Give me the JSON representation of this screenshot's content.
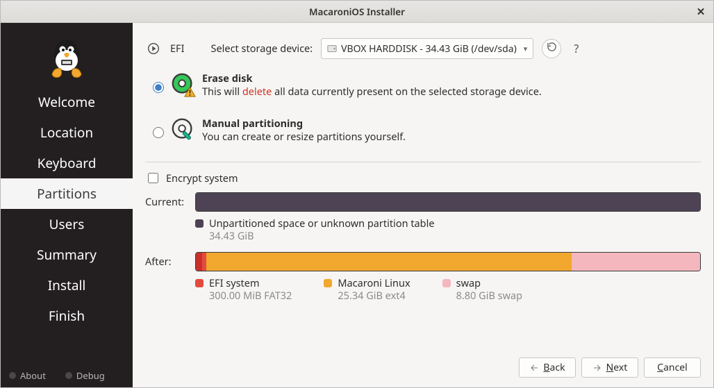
{
  "window": {
    "title": "MacaroniOS Installer"
  },
  "sidebar": {
    "items": [
      {
        "label": "Welcome"
      },
      {
        "label": "Location"
      },
      {
        "label": "Keyboard"
      },
      {
        "label": "Partitions"
      },
      {
        "label": "Users"
      },
      {
        "label": "Summary"
      },
      {
        "label": "Install"
      },
      {
        "label": "Finish"
      }
    ],
    "active_index": 3,
    "footer": {
      "about": "About",
      "debug": "Debug"
    }
  },
  "topbar": {
    "efi_label": "EFI",
    "select_label": "Select storage device:",
    "device_text": "VBOX HARDDISK    - 34.43 GiB (/dev/sda)",
    "help": "?"
  },
  "options": {
    "erase": {
      "title": "Erase disk",
      "desc_pre": "This will ",
      "desc_danger": "delete",
      "desc_post": " all data currently present on the selected storage device."
    },
    "manual": {
      "title": "Manual partitioning",
      "desc": "You can create or resize partitions yourself."
    },
    "selected": "erase"
  },
  "encrypt": {
    "label": "Encrypt system",
    "checked": false
  },
  "current": {
    "label": "Current:",
    "segments": [
      {
        "color": "#4d4354",
        "pct": 100
      }
    ],
    "legend": [
      {
        "swatch": "sw-dark",
        "name": "Unpartitioned space or unknown partition table",
        "sub": "34.43 GiB"
      }
    ]
  },
  "after": {
    "label": "After:",
    "segments": [
      {
        "color": "#c9302c",
        "pct": 1.2
      },
      {
        "color": "#e34b3d",
        "pct": 0.8
      },
      {
        "color": "#f2a72e",
        "pct": 72.5
      },
      {
        "color": "#f4b7bd",
        "pct": 25.5
      }
    ],
    "legend": [
      {
        "swatch": "sw-red",
        "name": "EFI system",
        "sub": "300.00 MiB  FAT32"
      },
      {
        "swatch": "sw-orng",
        "name": "Macaroni Linux",
        "sub": "25.34 GiB  ext4"
      },
      {
        "swatch": "sw-pink",
        "name": "swap",
        "sub": "8.80 GiB  swap"
      }
    ]
  },
  "buttons": {
    "back_mn": "B",
    "back_rest": "ack",
    "next_mn": "N",
    "next_rest": "ext",
    "cancel_mn": "C",
    "cancel_rest": "ancel"
  },
  "colors": {
    "danger": "#d13222"
  }
}
